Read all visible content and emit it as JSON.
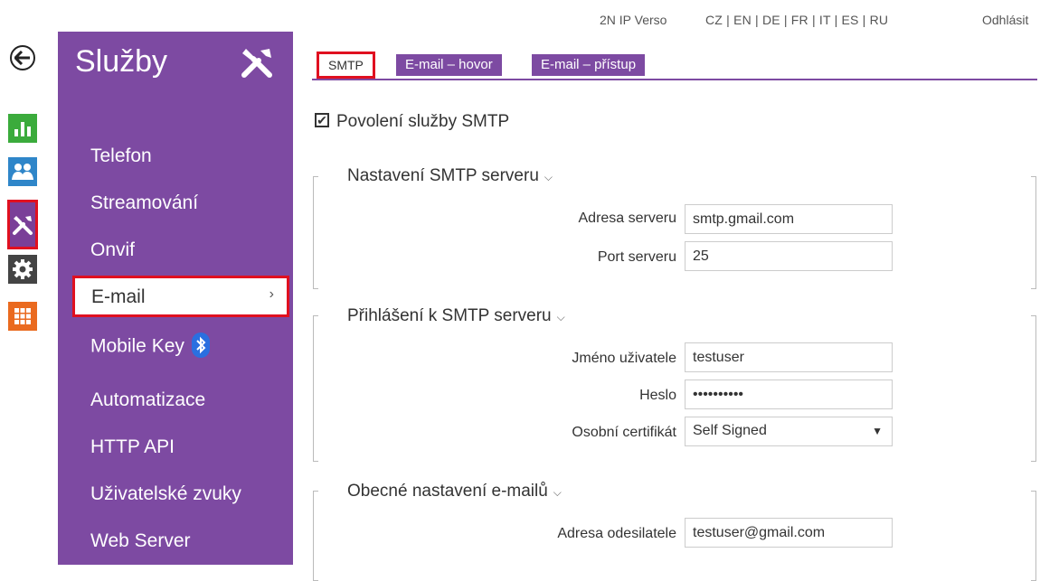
{
  "topbar": {
    "device": "2N IP Verso",
    "languages": "CZ | EN | DE | FR | IT | ES | RU",
    "logout": "Odhlásit"
  },
  "rail": [
    "stats-icon",
    "users-icon",
    "tools-icon",
    "gear-icon",
    "apps-icon"
  ],
  "sidebar": {
    "title": "Služby",
    "items": [
      {
        "label": "Telefon"
      },
      {
        "label": "Streamování"
      },
      {
        "label": "Onvif"
      },
      {
        "label": "E-mail",
        "active": true
      },
      {
        "label": "Mobile Key"
      },
      {
        "label": "Automatizace"
      },
      {
        "label": "HTTP API"
      },
      {
        "label": "Uživatelské zvuky"
      },
      {
        "label": "Web Server"
      }
    ]
  },
  "tabs": [
    {
      "label": "SMTP",
      "active": true
    },
    {
      "label": "E-mail – hovor"
    },
    {
      "label": "E-mail – přístup"
    }
  ],
  "enable_smtp": {
    "label": "Povolení služby SMTP",
    "checked": true
  },
  "sections": {
    "server": {
      "title": "Nastavení SMTP serveru",
      "address_label": "Adresa serveru",
      "address_value": "smtp.gmail.com",
      "port_label": "Port serveru",
      "port_value": "25"
    },
    "login": {
      "title": "Přihlášení k SMTP serveru",
      "user_label": "Jméno uživatele",
      "user_value": "testuser",
      "password_label": "Heslo",
      "password_value": "••••••••••",
      "cert_label": "Osobní certifikát",
      "cert_value": "Self Signed"
    },
    "general": {
      "title": "Obecné nastavení e-mailů",
      "sender_label": "Adresa odesilatele",
      "sender_value": "testuser@gmail.com"
    }
  },
  "colors": {
    "accent": "#7d4aa2",
    "highlight": "#e01020"
  }
}
